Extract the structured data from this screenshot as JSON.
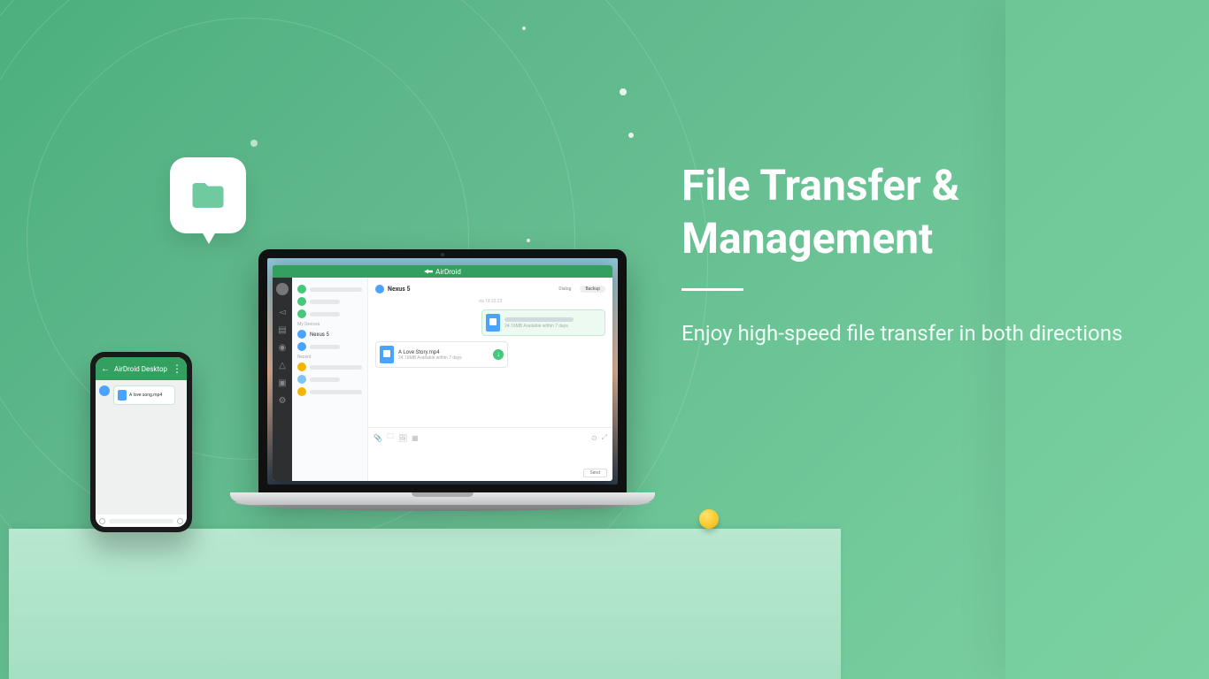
{
  "hero": {
    "title_line1": "File Transfer &",
    "title_line2": "Management",
    "subtitle": "Enjoy high-speed file transfer in both directions"
  },
  "app": {
    "brand": "AirDroid",
    "list": {
      "section_myDevices": "My Devices",
      "section_recent": "Recent",
      "device": "Nexus 5"
    },
    "chat": {
      "contact": "Nexus 5",
      "tab_dialog": "Dialog",
      "tab_backup": "Backup",
      "timestamp": "via 18 22:23",
      "outgoing": {
        "meta": "24.16MB  Available within 7 days"
      },
      "incoming": {
        "name": "A Love Story.mp4",
        "meta": "24.16MB  Available within 7 days"
      },
      "send": "Send"
    }
  },
  "phone": {
    "title": "AirDroid Desktop",
    "file_name": "A love song.mp4"
  }
}
